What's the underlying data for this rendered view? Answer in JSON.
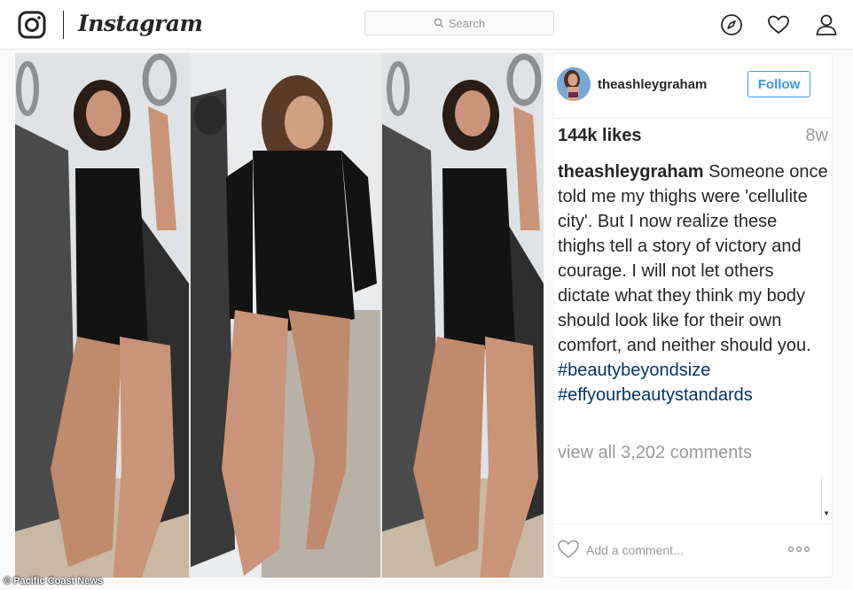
{
  "nav": {
    "wordmark": "Instagram",
    "search_placeholder": "Search",
    "icons": [
      "instagram-logo-icon",
      "search-icon",
      "compass-icon",
      "heart-icon",
      "profile-icon"
    ]
  },
  "post": {
    "username": "theashleygraham",
    "follow_label": "Follow",
    "likes": "144k likes",
    "time_ago": "8w",
    "caption_user": "theashleygraham",
    "caption_text": "Someone once told me my thighs were 'cellulite city'. But I now realize these thighs tell a story of victory and courage. I will not let others dictate what they think my body should look like for their own comfort, and neither should you.",
    "hashtags": [
      "#beautybeyondsize",
      "#effyourbeautystandards"
    ],
    "view_comments": "view all 3,202 comments",
    "add_comment_placeholder": "Add a comment...",
    "more_icon": "more-options-icon"
  },
  "watermark": "© Pacific Coast News",
  "colors": {
    "link_blue": "#3897f0",
    "hashtag": "#003569",
    "muted": "#999999",
    "text": "#262626"
  }
}
